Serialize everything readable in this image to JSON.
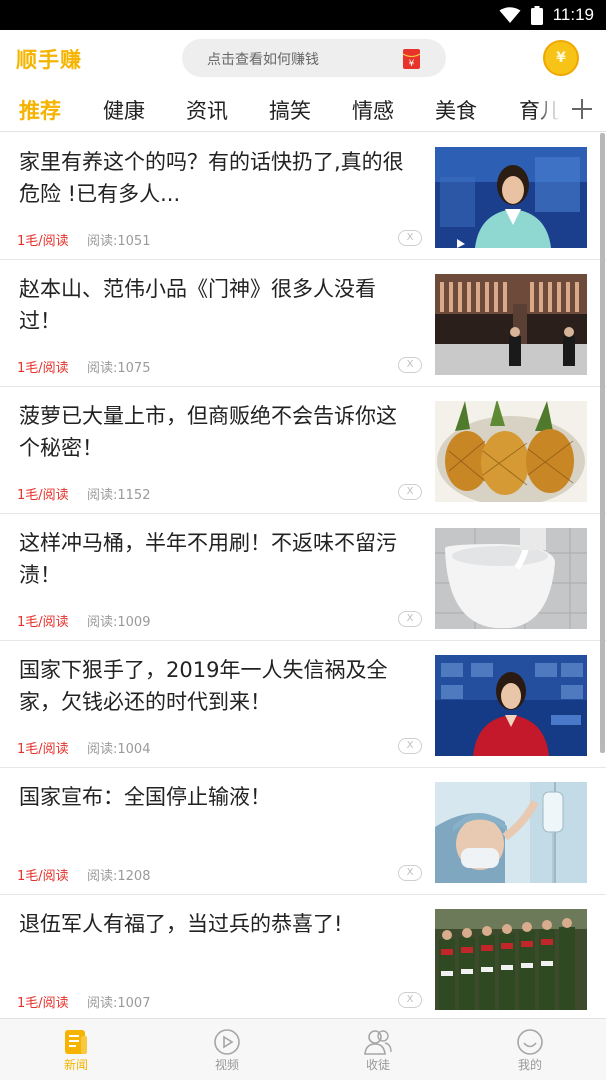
{
  "status_bar": {
    "time": "11:19"
  },
  "header": {
    "logo": "顺手赚",
    "search_placeholder": "点击查看如何赚钱",
    "coin_symbol": "¥",
    "accent_color": "#f5b400"
  },
  "tabs": [
    {
      "label": "推荐",
      "active": true
    },
    {
      "label": "健康"
    },
    {
      "label": "资讯"
    },
    {
      "label": "搞笑"
    },
    {
      "label": "情感"
    },
    {
      "label": "美食"
    },
    {
      "label": "育儿"
    }
  ],
  "articles": [
    {
      "title": "家里有养这个的吗？有的话快扔了,真的很危险 !已有多人...",
      "reward": "1毛/阅读",
      "reads": "阅读:1051",
      "thumb": "news-anchor-blue"
    },
    {
      "title": "赵本山、范伟小品《门神》很多人没看过！",
      "reward": "1毛/阅读",
      "reads": "阅读:1075",
      "thumb": "stage-scene"
    },
    {
      "title": "菠萝已大量上市，但商贩绝不会告诉你这个秘密！",
      "reward": "1毛/阅读",
      "reads": "阅读:1152",
      "thumb": "pineapples"
    },
    {
      "title": "这样冲马桶，半年不用刷！不返味不留污渍！",
      "reward": "1毛/阅读",
      "reads": "阅读:1009",
      "thumb": "toilet"
    },
    {
      "title": "国家下狠手了，2019年一人失信祸及全家，欠钱必还的时代到来！",
      "reward": "1毛/阅读",
      "reads": "阅读:1004",
      "thumb": "news-anchor-red"
    },
    {
      "title": "国家宣布：全国停止输液！",
      "reward": "1毛/阅读",
      "reads": "阅读:1208",
      "thumb": "iv-drip"
    },
    {
      "title": "退伍军人有福了，当过兵的恭喜了!",
      "reward": "1毛/阅读",
      "reads": "阅读:1007",
      "thumb": "soldiers"
    }
  ],
  "dismiss_label": "X",
  "bottom_nav": [
    {
      "label": "新闻",
      "icon": "news-icon",
      "active": true
    },
    {
      "label": "视频",
      "icon": "video-icon"
    },
    {
      "label": "收徒",
      "icon": "apprentice-icon"
    },
    {
      "label": "我的",
      "icon": "profile-icon"
    }
  ]
}
